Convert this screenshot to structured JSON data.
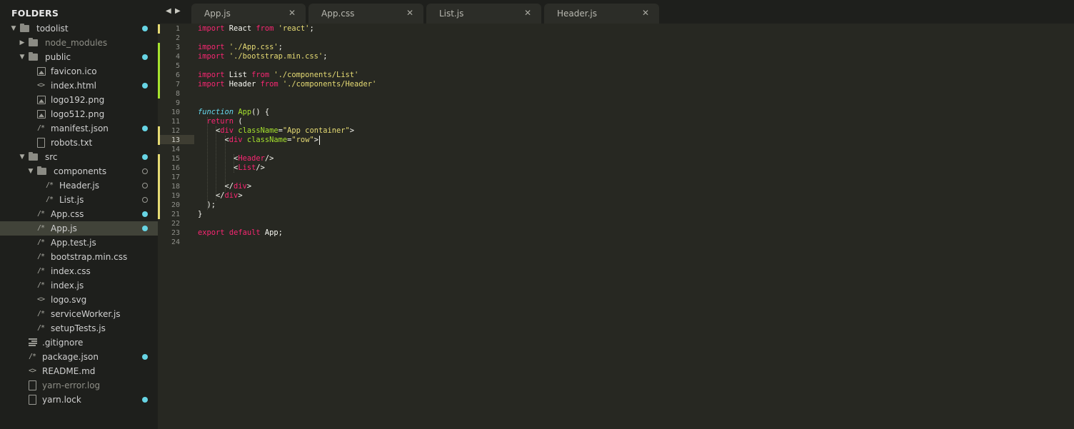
{
  "sidebar": {
    "header": "FOLDERS",
    "items": [
      {
        "label": "todolist",
        "depth": 0,
        "kind": "folder-open",
        "status": "modified"
      },
      {
        "label": "node_modules",
        "depth": 1,
        "kind": "folder-closed",
        "status": "none",
        "dim": true
      },
      {
        "label": "public",
        "depth": 1,
        "kind": "folder-open",
        "status": "modified"
      },
      {
        "label": "favicon.ico",
        "depth": 2,
        "kind": "image",
        "status": "none"
      },
      {
        "label": "index.html",
        "depth": 2,
        "kind": "code",
        "status": "modified"
      },
      {
        "label": "logo192.png",
        "depth": 2,
        "kind": "image",
        "status": "none"
      },
      {
        "label": "logo512.png",
        "depth": 2,
        "kind": "image",
        "status": "none"
      },
      {
        "label": "manifest.json",
        "depth": 2,
        "kind": "script",
        "status": "modified"
      },
      {
        "label": "robots.txt",
        "depth": 2,
        "kind": "file",
        "status": "none"
      },
      {
        "label": "src",
        "depth": 1,
        "kind": "folder-open",
        "status": "modified"
      },
      {
        "label": "components",
        "depth": 2,
        "kind": "folder-open",
        "status": "untracked"
      },
      {
        "label": "Header.js",
        "depth": 3,
        "kind": "script",
        "status": "untracked"
      },
      {
        "label": "List.js",
        "depth": 3,
        "kind": "script",
        "status": "untracked"
      },
      {
        "label": "App.css",
        "depth": 2,
        "kind": "script",
        "status": "modified"
      },
      {
        "label": "App.js",
        "depth": 2,
        "kind": "script",
        "status": "modified",
        "selected": true
      },
      {
        "label": "App.test.js",
        "depth": 2,
        "kind": "script",
        "status": "none"
      },
      {
        "label": "bootstrap.min.css",
        "depth": 2,
        "kind": "script",
        "status": "none"
      },
      {
        "label": "index.css",
        "depth": 2,
        "kind": "script",
        "status": "none"
      },
      {
        "label": "index.js",
        "depth": 2,
        "kind": "script",
        "status": "none"
      },
      {
        "label": "logo.svg",
        "depth": 2,
        "kind": "code",
        "status": "none"
      },
      {
        "label": "serviceWorker.js",
        "depth": 2,
        "kind": "script",
        "status": "none"
      },
      {
        "label": "setupTests.js",
        "depth": 2,
        "kind": "script",
        "status": "none"
      },
      {
        "label": ".gitignore",
        "depth": 1,
        "kind": "lines",
        "status": "none"
      },
      {
        "label": "package.json",
        "depth": 1,
        "kind": "script",
        "status": "modified"
      },
      {
        "label": "README.md",
        "depth": 1,
        "kind": "code",
        "status": "none"
      },
      {
        "label": "yarn-error.log",
        "depth": 1,
        "kind": "file",
        "status": "none",
        "dim": true
      },
      {
        "label": "yarn.lock",
        "depth": 1,
        "kind": "file",
        "status": "modified"
      }
    ]
  },
  "tabs": [
    {
      "label": "App.js",
      "active": true,
      "close": "✕"
    },
    {
      "label": "App.css",
      "active": false,
      "close": "✕"
    },
    {
      "label": "List.js",
      "active": false,
      "close": "✕"
    },
    {
      "label": "Header.js",
      "active": false,
      "close": "✕"
    }
  ],
  "editor": {
    "current_line": 13,
    "line_numbers": [
      "1",
      "2",
      "3",
      "4",
      "5",
      "6",
      "7",
      "8",
      "9",
      "10",
      "11",
      "12",
      "13",
      "14",
      "15",
      "16",
      "17",
      "18",
      "19",
      "20",
      "21",
      "22",
      "23",
      "24"
    ],
    "gutter_marks": [
      {
        "line": 1,
        "type": "mod"
      },
      {
        "line": 3,
        "type": "add"
      },
      {
        "line": 4,
        "type": "add"
      },
      {
        "line": 5,
        "type": "add"
      },
      {
        "line": 6,
        "type": "add"
      },
      {
        "line": 7,
        "type": "add"
      },
      {
        "line": 8,
        "type": "add"
      },
      {
        "line": 12,
        "type": "mod"
      },
      {
        "line": 13,
        "type": "mod"
      },
      {
        "line": 15,
        "type": "mod"
      },
      {
        "line": 16,
        "type": "mod"
      },
      {
        "line": 17,
        "type": "mod"
      },
      {
        "line": 18,
        "type": "mod"
      },
      {
        "line": 19,
        "type": "mod"
      },
      {
        "line": 20,
        "type": "mod"
      },
      {
        "line": 21,
        "type": "mod"
      }
    ],
    "lines": [
      [
        [
          "k",
          "import"
        ],
        [
          "t",
          " React "
        ],
        [
          "k",
          "from"
        ],
        [
          "t",
          " "
        ],
        [
          "s",
          "'react'"
        ],
        [
          "t",
          ";"
        ]
      ],
      [],
      [
        [
          "k",
          "import"
        ],
        [
          "t",
          " "
        ],
        [
          "s",
          "'./App.css'"
        ],
        [
          "t",
          ";"
        ]
      ],
      [
        [
          "k",
          "import"
        ],
        [
          "t",
          " "
        ],
        [
          "s",
          "'./bootstrap.min.css'"
        ],
        [
          "t",
          ";"
        ]
      ],
      [],
      [
        [
          "k",
          "import"
        ],
        [
          "t",
          " List "
        ],
        [
          "k",
          "from"
        ],
        [
          "t",
          " "
        ],
        [
          "s",
          "'./components/List'"
        ]
      ],
      [
        [
          "k",
          "import"
        ],
        [
          "t",
          " Header "
        ],
        [
          "k",
          "from"
        ],
        [
          "t",
          " "
        ],
        [
          "s",
          "'./components/Header'"
        ]
      ],
      [],
      [],
      [
        [
          "i",
          "function"
        ],
        [
          "t",
          " "
        ],
        [
          "f",
          "App"
        ],
        [
          "t",
          "() {"
        ]
      ],
      [
        [
          "t",
          "  "
        ],
        [
          "k",
          "return"
        ],
        [
          "t",
          " ("
        ]
      ],
      [
        [
          "t",
          "    <"
        ],
        [
          "k",
          "div"
        ],
        [
          "t",
          " "
        ],
        [
          "a",
          "className"
        ],
        [
          "t",
          "="
        ],
        [
          "s",
          "\"App container\""
        ],
        [
          "t",
          ">"
        ]
      ],
      [
        [
          "t",
          "      <"
        ],
        [
          "k",
          "div"
        ],
        [
          "t",
          " "
        ],
        [
          "a",
          "className"
        ],
        [
          "t",
          "="
        ],
        [
          "s",
          "\"row\""
        ],
        [
          "t",
          ">"
        ]
      ],
      [],
      [
        [
          "t",
          "        <"
        ],
        [
          "k",
          "Header"
        ],
        [
          "t",
          "/>"
        ]
      ],
      [
        [
          "t",
          "        <"
        ],
        [
          "k",
          "List"
        ],
        [
          "t",
          "/>"
        ]
      ],
      [],
      [
        [
          "t",
          "      </"
        ],
        [
          "k",
          "div"
        ],
        [
          "t",
          ">"
        ]
      ],
      [
        [
          "t",
          "    </"
        ],
        [
          "k",
          "div"
        ],
        [
          "t",
          ">"
        ]
      ],
      [
        [
          "t",
          "  );"
        ]
      ],
      [
        [
          "t",
          "}"
        ]
      ],
      [],
      [
        [
          "k",
          "export"
        ],
        [
          "t",
          " "
        ],
        [
          "k",
          "default"
        ],
        [
          "t",
          " App;"
        ]
      ],
      []
    ]
  },
  "colors": {
    "accent_dot": "#67d4e4",
    "keyword": "#f92672",
    "string": "#e6db74",
    "function": "#a6e22e",
    "storage": "#66d9ef",
    "modified_mark": "#e6db74",
    "added_mark": "#a6e22e"
  },
  "icons": {
    "nav_back": "◀",
    "nav_forward": "▶",
    "arrow_open": "▼",
    "arrow_closed": "▶",
    "code_glyph": "<>",
    "script_glyph": "/*"
  }
}
